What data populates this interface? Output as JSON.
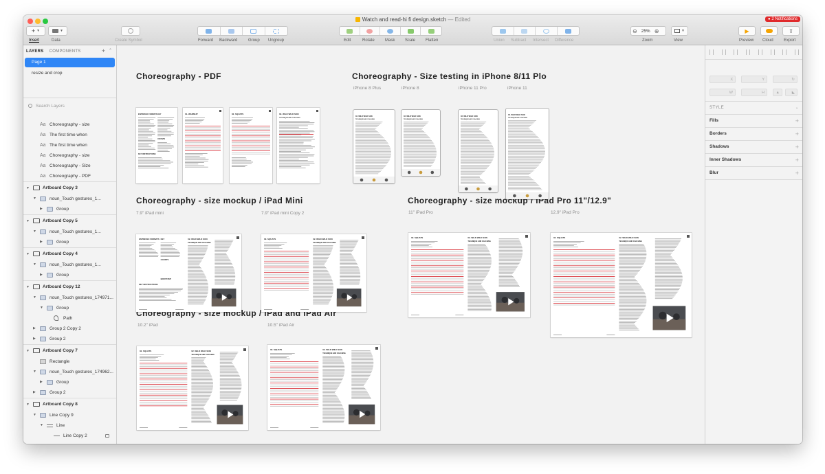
{
  "window": {
    "title": "Watch and read-hi fi design.sketch",
    "edited_label": "— Edited",
    "notifications": "2 Notifications"
  },
  "toolbar": {
    "insert": "Insert",
    "data": "Data",
    "create_symbol": "Create Symbol",
    "forward": "Forward",
    "backward": "Backward",
    "group": "Group",
    "ungroup": "Ungroup",
    "edit": "Edit",
    "rotate": "Rotate",
    "mask": "Mask",
    "scale": "Scale",
    "flatten": "Flatten",
    "union": "Union",
    "subtract": "Subtract",
    "intersect": "Intersect",
    "difference": "Difference",
    "zoom_label": "Zoom",
    "zoom_value": "25%",
    "view": "View",
    "preview": "Preview",
    "cloud": "Cloud",
    "export": "Export",
    "colors": {
      "accent": "#2f86f6",
      "notif": "#e0292b",
      "preview": "#f5a300"
    }
  },
  "sidebar": {
    "tab_layers": "LAYERS",
    "tab_components": "COMPONENTS",
    "pages": [
      "Page 1",
      "resize and crop"
    ],
    "search_placeholder": "Search Layers",
    "layers": [
      {
        "name": "Choreography - size",
        "icon": "text",
        "indent": 1,
        "disc": ""
      },
      {
        "name": "The first time when",
        "icon": "text",
        "indent": 1,
        "disc": ""
      },
      {
        "name": "The first time when",
        "icon": "text",
        "indent": 1,
        "disc": ""
      },
      {
        "name": "Choreography - size",
        "icon": "text",
        "indent": 1,
        "disc": ""
      },
      {
        "name": "Choreography - Size",
        "icon": "text",
        "indent": 1,
        "disc": ""
      },
      {
        "name": "Choreography - PDF",
        "icon": "text",
        "indent": 1,
        "disc": ""
      },
      {
        "name": "Artboard Copy 3",
        "icon": "screen",
        "indent": 0,
        "disc": "down",
        "artboard": true
      },
      {
        "name": "noun_Touch gestures_1...",
        "icon": "folder",
        "indent": 1,
        "disc": "down"
      },
      {
        "name": "Group",
        "icon": "folder",
        "indent": 2,
        "disc": "right"
      },
      {
        "name": "Artboard Copy 5",
        "icon": "screen",
        "indent": 0,
        "disc": "down",
        "artboard": true
      },
      {
        "name": "noun_Touch gestures_1...",
        "icon": "folder",
        "indent": 1,
        "disc": "down"
      },
      {
        "name": "Group",
        "icon": "folder",
        "indent": 2,
        "disc": "right"
      },
      {
        "name": "Artboard Copy 4",
        "icon": "screen",
        "indent": 0,
        "disc": "down",
        "artboard": true
      },
      {
        "name": "noun_Touch gestures_1...",
        "icon": "folder",
        "indent": 1,
        "disc": "down"
      },
      {
        "name": "Group",
        "icon": "folder",
        "indent": 2,
        "disc": "right"
      },
      {
        "name": "Artboard Copy 12",
        "icon": "screen",
        "indent": 0,
        "disc": "down",
        "artboard": true
      },
      {
        "name": "noun_Touch gestures_174971...",
        "icon": "folder",
        "indent": 1,
        "disc": "down"
      },
      {
        "name": "Group",
        "icon": "folder",
        "indent": 2,
        "disc": "down"
      },
      {
        "name": "Path",
        "icon": "path",
        "indent": 3,
        "disc": ""
      },
      {
        "name": "Group 2 Copy 2",
        "icon": "folder",
        "indent": 1,
        "disc": "right"
      },
      {
        "name": "Group 2",
        "icon": "folder",
        "indent": 1,
        "disc": "right"
      },
      {
        "name": "Artboard Copy 7",
        "icon": "screen",
        "indent": 0,
        "disc": "down",
        "artboard": true
      },
      {
        "name": "Rectangle",
        "icon": "rect",
        "indent": 1,
        "disc": ""
      },
      {
        "name": "noun_Touch gestures_174962...",
        "icon": "folder",
        "indent": 1,
        "disc": "down"
      },
      {
        "name": "Group",
        "icon": "folder",
        "indent": 2,
        "disc": "right"
      },
      {
        "name": "Group 2",
        "icon": "folder",
        "indent": 1,
        "disc": "right"
      },
      {
        "name": "Artboard Copy 8",
        "icon": "screen",
        "indent": 0,
        "disc": "down",
        "artboard": true
      },
      {
        "name": "Line Copy 9",
        "icon": "folder",
        "indent": 1,
        "disc": "down"
      },
      {
        "name": "Line",
        "icon": "lines",
        "indent": 2,
        "disc": "down"
      },
      {
        "name": "Line Copy 2",
        "icon": "line",
        "indent": 3,
        "disc": "",
        "lock": true
      }
    ]
  },
  "canvas": {
    "sections": [
      {
        "title": "Choreography - PDF"
      },
      {
        "title": "Choreography - Size testing in iPhone 8/11 Plo"
      },
      {
        "title": "Choreography - size mockup / iPad Mini"
      },
      {
        "title": "Choreography - size mockup / iPad Pro 11\"/12.9\""
      },
      {
        "title": "Choreography - size mockup / iPad and iPad Air"
      }
    ],
    "phone_labels": [
      "iPhone 8 Plus",
      "iPhone 8",
      "iPhone 11 Pro",
      "iPhone 11"
    ],
    "ipad_mini_labels": [
      "7.9\" iPad mini",
      "7.9\" iPad mini Copy 2"
    ],
    "ipad_pro_labels": [
      "11\" iPad Pro",
      "12.9\" iPad Pro"
    ],
    "ipad_air_labels": [
      "10.2\" iPad",
      "10.5\" iPad Air"
    ],
    "artboard_texts": {
      "formats": "ESPRESSO FORMATS",
      "key": "KEY",
      "warmup": "01. WARMUP",
      "squats": "02. SQUATS",
      "wild": "02. WILD WILD SON",
      "technique": "TECHNIQUE AND COACHING",
      "key_instructions": "KEY INSTRUCTIONS",
      "counts": "COUNTS",
      "bodystep": "BODYSTEP"
    }
  },
  "inspector": {
    "x": "X",
    "y": "Y",
    "w": "W",
    "h": "H",
    "style_head": "STYLE",
    "rows": [
      "Fills",
      "Borders",
      "Shadows",
      "Inner Shadows",
      "Blur"
    ]
  }
}
